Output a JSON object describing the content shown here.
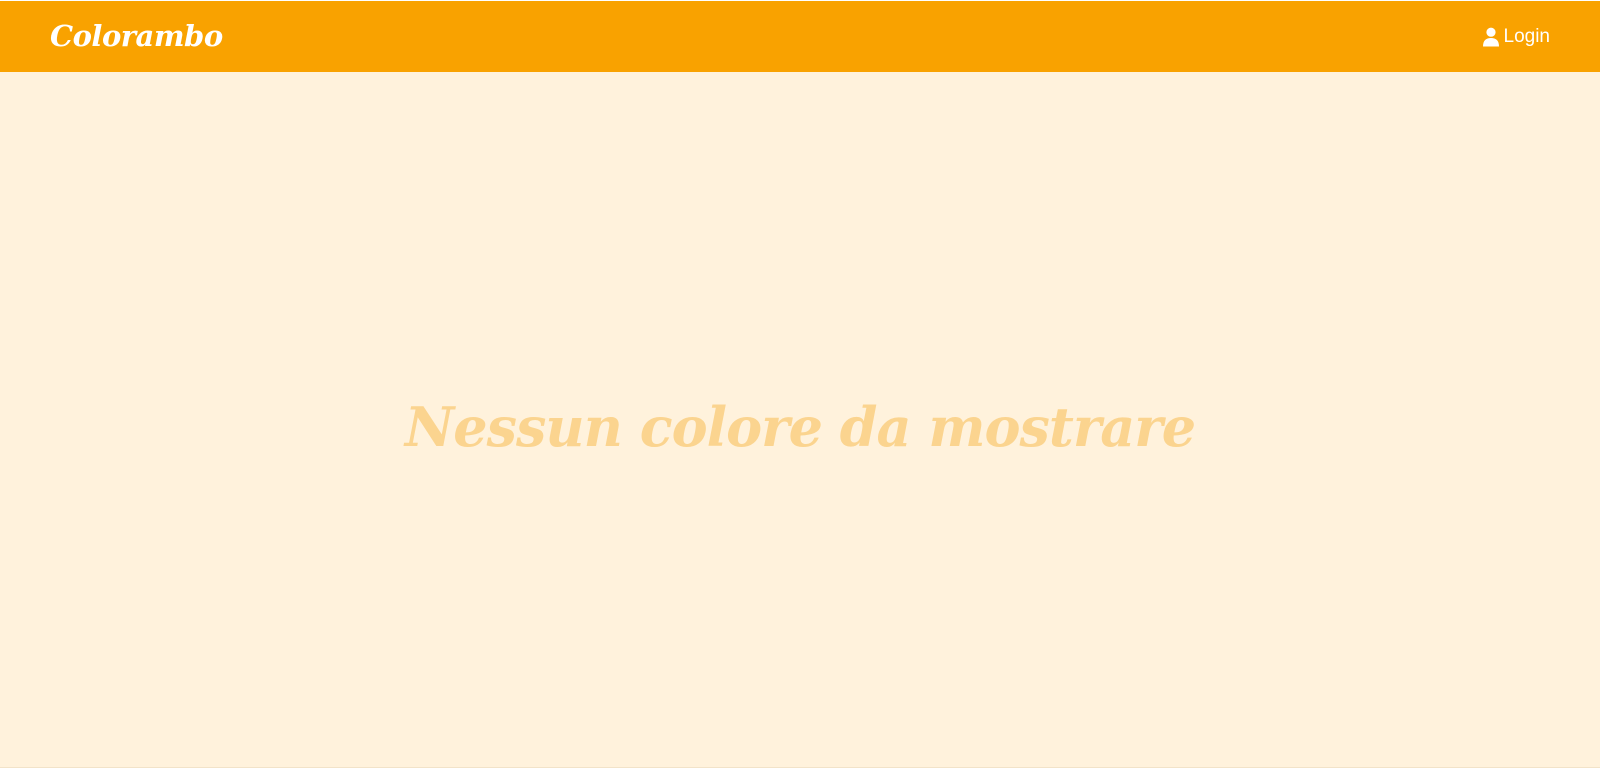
{
  "navbar": {
    "brand": "Colorambo",
    "login_label": "Login",
    "login_icon": "user-icon",
    "background_color": "#f9a200"
  },
  "main": {
    "empty_message": "Nessun colore da mostrare",
    "background_color": "#fff2dc",
    "message_color": "#fbd48f"
  }
}
